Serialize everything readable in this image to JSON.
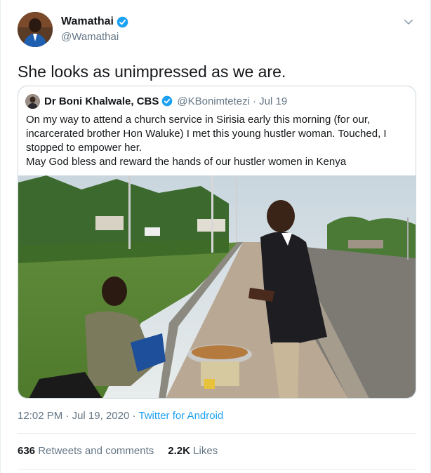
{
  "author": {
    "name": "Wamathai",
    "handle": "@Wamathai"
  },
  "tweet": {
    "text": "She looks as unimpressed as we are.",
    "time": "12:02 PM",
    "date": "Jul 19, 2020",
    "separator": "·",
    "source": "Twitter for Android"
  },
  "quoted": {
    "name": "Dr Boni Khalwale, CBS",
    "handle": "@KBonimtetezi",
    "date": "· Jul 19",
    "lines": [
      "On my way to attend a church service in Sirisia early this morning (for our,",
      "incarcerated brother Hon Waluke) I met this young hustler woman. Touched, I",
      "stopped to empower her.",
      "May God bless and reward the hands of our hustler women in Kenya"
    ]
  },
  "stats": {
    "retweets_count": "636",
    "retweets_label": "Retweets and comments",
    "likes_count": "2.2K",
    "likes_label": "Likes"
  },
  "icons": {
    "verified": "verified-badge-icon",
    "menu": "chevron-down-icon"
  },
  "colors": {
    "accent": "#1da1f2",
    "secondary_text": "#657786",
    "border": "#ccd6dd"
  }
}
